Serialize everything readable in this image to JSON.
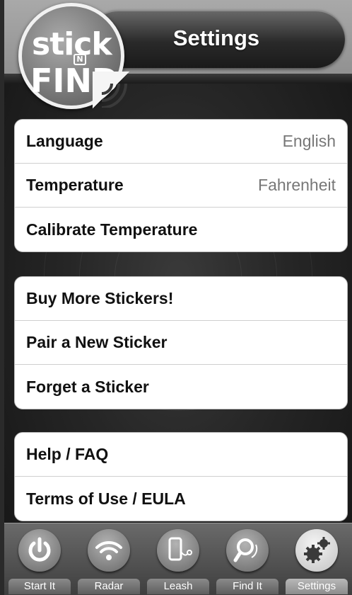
{
  "header": {
    "title": "Settings",
    "logo_text_top": "stick",
    "logo_text_mid": "N",
    "logo_text_bottom": "FIND"
  },
  "groups": [
    {
      "rows": [
        {
          "label": "Language",
          "value": "English"
        },
        {
          "label": "Temperature",
          "value": "Fahrenheit"
        },
        {
          "label": "Calibrate Temperature",
          "value": ""
        }
      ]
    },
    {
      "rows": [
        {
          "label": "Buy More Stickers!",
          "value": ""
        },
        {
          "label": "Pair a New Sticker",
          "value": ""
        },
        {
          "label": "Forget a Sticker",
          "value": ""
        }
      ]
    },
    {
      "rows": [
        {
          "label": "Help / FAQ",
          "value": ""
        },
        {
          "label": "Terms of Use / EULA",
          "value": ""
        }
      ]
    }
  ],
  "tabbar": {
    "tabs": [
      {
        "label": "Start It",
        "icon": "power-icon",
        "active": false
      },
      {
        "label": "Radar",
        "icon": "wifi-icon",
        "active": false
      },
      {
        "label": "Leash",
        "icon": "phone-leash-icon",
        "active": false
      },
      {
        "label": "Find It",
        "icon": "magnifier-icon",
        "active": false
      },
      {
        "label": "Settings",
        "icon": "gears-icon",
        "active": true
      }
    ]
  },
  "colors": {
    "header_bg": "#9a9a9a",
    "screen_bg": "#262626",
    "row_value": "#777777"
  }
}
